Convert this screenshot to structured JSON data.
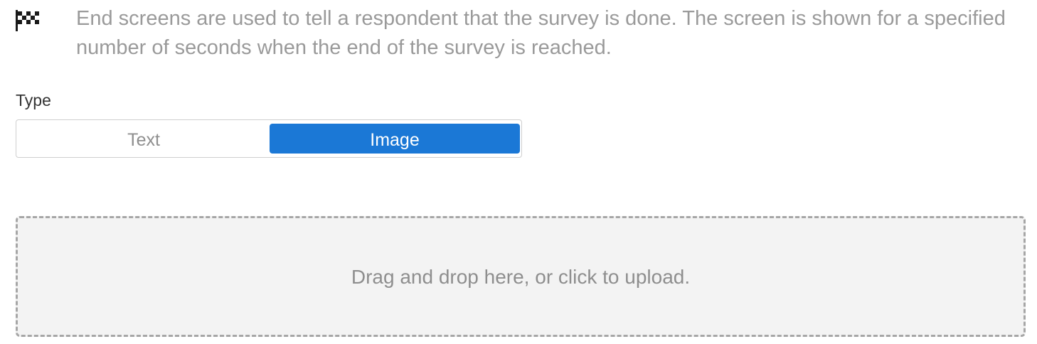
{
  "info": {
    "icon": "checkered-flag-icon",
    "text": "End screens are used to tell a respondent that the survey is done. The screen is shown for a specified number of seconds when the end of the survey is reached."
  },
  "type_field": {
    "label": "Type",
    "options": [
      {
        "label": "Text",
        "selected": false
      },
      {
        "label": "Image",
        "selected": true
      }
    ],
    "selected_color": "#1b78d6"
  },
  "upload": {
    "prompt": "Drag and drop here, or click to upload."
  }
}
